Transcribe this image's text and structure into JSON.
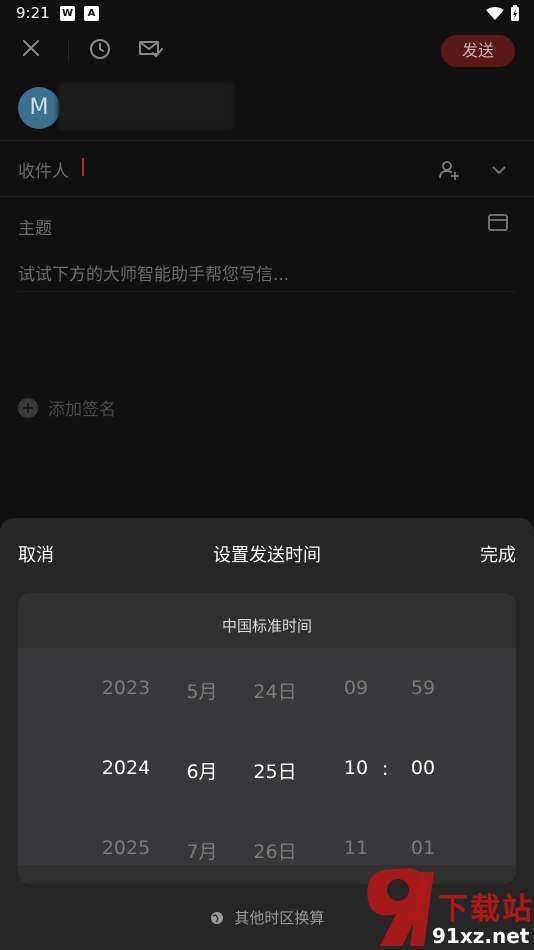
{
  "status_bar": {
    "time": "9:21",
    "app_icon_1": "W",
    "app_icon_2": "A"
  },
  "toolbar": {
    "send_label": "发送"
  },
  "sender": {
    "avatar_letter": "M"
  },
  "fields": {
    "recipient_label": "收件人",
    "subject_label": "主题"
  },
  "body": {
    "placeholder": "试试下方的大师智能助手帮您写信..."
  },
  "signature": {
    "label": "添加签名"
  },
  "sheet": {
    "cancel": "取消",
    "title": "设置发送时间",
    "done": "完成",
    "timezone": "中国标准时间",
    "convert": "其他时区换算",
    "years": [
      "2023",
      "2024",
      "2025"
    ],
    "months": [
      "5月",
      "6月",
      "7月"
    ],
    "days": [
      "24日",
      "25日",
      "26日"
    ],
    "hours": [
      "09",
      "10",
      "11"
    ],
    "minutes": [
      "59",
      "00",
      "01"
    ],
    "separator": ":"
  },
  "watermark": {
    "brand": "下载站",
    "site": "91xz.net"
  }
}
